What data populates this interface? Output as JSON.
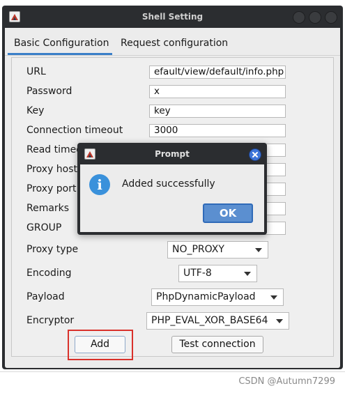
{
  "window": {
    "title": "Shell Setting"
  },
  "tabs": [
    {
      "label": "Basic Configuration",
      "active": true
    },
    {
      "label": "Request configuration",
      "active": false
    }
  ],
  "form": {
    "url": {
      "label": "URL",
      "value": "efault/view/default/info.php"
    },
    "password": {
      "label": "Password",
      "value": "x"
    },
    "key": {
      "label": "Key",
      "value": "key"
    },
    "connection_timeout": {
      "label": "Connection timeout",
      "value": "3000"
    },
    "read_timeout": {
      "label": "Read timeo",
      "value": ""
    },
    "proxy_host": {
      "label": "Proxy host",
      "value": ""
    },
    "proxy_port": {
      "label": "Proxy port",
      "value": ""
    },
    "remarks": {
      "label": "Remarks",
      "value": ""
    },
    "group": {
      "label": "GROUP",
      "value": ""
    },
    "proxy_type": {
      "label": "Proxy type",
      "selected": "NO_PROXY"
    },
    "encoding": {
      "label": "Encoding",
      "selected": "UTF-8"
    },
    "payload": {
      "label": "Payload",
      "selected": "PhpDynamicPayload"
    },
    "encryptor": {
      "label": "Encryptor",
      "selected": "PHP_EVAL_XOR_BASE64"
    }
  },
  "buttons": {
    "add": "Add",
    "test_connection": "Test connection"
  },
  "dialog": {
    "title": "Prompt",
    "message": "Added successfully",
    "info_glyph": "i",
    "ok": "OK"
  },
  "colors": {
    "titlebar": "#2b2d30",
    "accent": "#3a7fc8",
    "ok_button": "#5b8fd0",
    "highlight_box": "#d9312b"
  },
  "watermark": "CSDN @Autumn7299"
}
